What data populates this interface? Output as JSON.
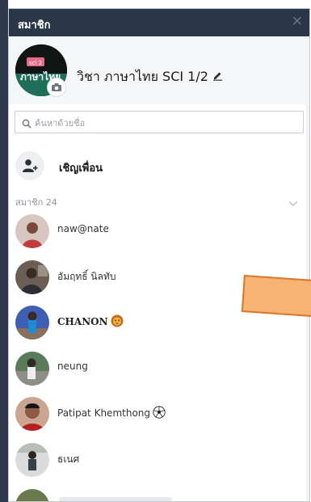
{
  "window": {
    "title": "สมาชิก",
    "close_glyph": "×",
    "title_bar_color": "#293749"
  },
  "group": {
    "name": "วิชา ภาษาไทย SCI 1/2",
    "avatar_text": "ภาษาไทย",
    "avatar_badge": "sci 2",
    "edit_icon": "pencil-icon",
    "camera_icon": "camera-icon"
  },
  "search": {
    "placeholder": "ค้นหาด้วยชื่อ",
    "value": "",
    "icon": "search-icon"
  },
  "invite": {
    "label": "เชิญเพื่อน",
    "icon": "add-person-icon"
  },
  "members": {
    "count_label": "สมาชิก 24",
    "collapse_icon": "chevron-down-icon",
    "list": [
      {
        "name": "naw@nate",
        "avatar_color": "#d8c6c0"
      },
      {
        "name": "อัมฤทธิ์ นิลทับ",
        "avatar_color": "#6b5e55"
      },
      {
        "name": "CHANON",
        "emoji": "lion-icon",
        "avatar_color": "#3e5fb4"
      },
      {
        "name": "neung",
        "avatar_color": "#5b7a5a"
      },
      {
        "name": "Patipat Khemthong",
        "emoji": "soccer-ball-icon",
        "avatar_color": "#2a2a2a"
      },
      {
        "name": "ธเนศ",
        "avatar_color": "#b9bdb8"
      }
    ]
  },
  "colors": {
    "accent_orange": "#f8b274",
    "accent_orange_border": "#d8782c"
  }
}
